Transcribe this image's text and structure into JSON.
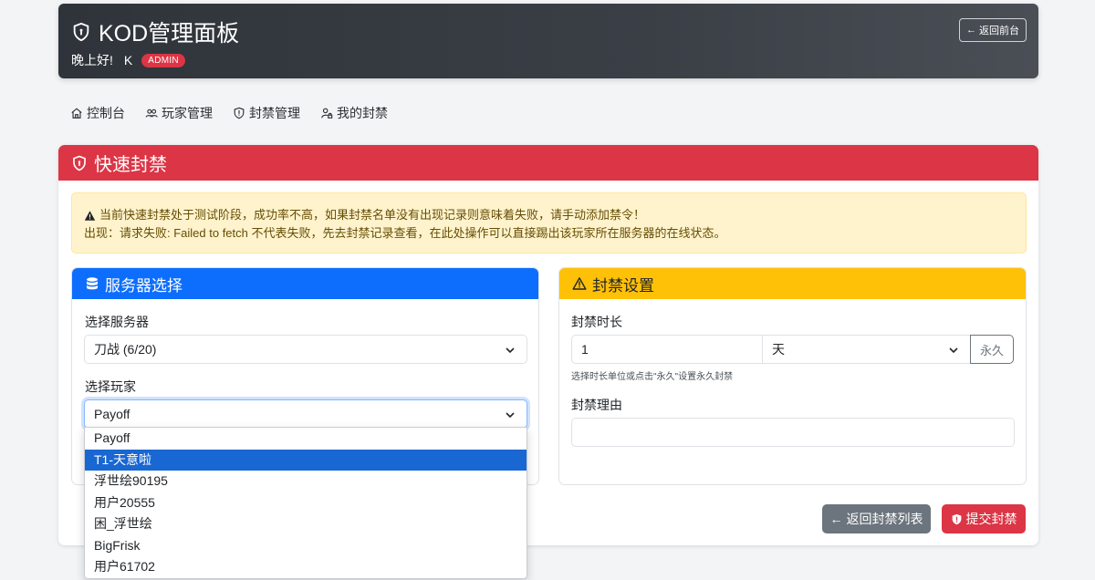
{
  "header": {
    "title": "KOD管理面板",
    "greeting": "晚上好!",
    "username": "K",
    "role_badge": "ADMIN",
    "back_button": "返回前台"
  },
  "nav": {
    "items": [
      {
        "label": "控制台",
        "icon": "home-icon"
      },
      {
        "label": "玩家管理",
        "icon": "users-icon"
      },
      {
        "label": "封禁管理",
        "icon": "shield-icon"
      },
      {
        "label": "我的封禁",
        "icon": "user-lock-icon"
      }
    ]
  },
  "main": {
    "title": "快速封禁",
    "alert_line1": "当前快速封禁处于测试阶段，成功率不高，如果封禁名单没有出现记录则意味着失败，请手动添加禁令！",
    "alert_line2": "出现：请求失败: Failed to fetch 不代表失败，先去封禁记录查看，在此处操作可以直接踢出该玩家所在服务器的在线状态。"
  },
  "server_panel": {
    "title": "服务器选择",
    "server_label": "选择服务器",
    "server_value": "刀战 (6/20)",
    "player_label": "选择玩家",
    "player_value": "Payoff",
    "player_options": [
      "Payoff",
      "T1-天意啦",
      "浮世绘90195",
      "用户20555",
      "困_浮世绘",
      "BigFrisk",
      "用户61702"
    ],
    "highlighted_option": "T1-天意啦"
  },
  "ban_panel": {
    "title": "封禁设置",
    "duration_label": "封禁时长",
    "duration_value": "1",
    "unit_value": "天",
    "permanent_button": "永久",
    "duration_help": "选择时长单位或点击\"永久\"设置永久封禁",
    "reason_label": "封禁理由",
    "reason_value": ""
  },
  "actions": {
    "back_list": "返回封禁列表",
    "submit": "提交封禁"
  },
  "colors": {
    "danger": "#dc3545",
    "primary": "#0d6efd",
    "warning": "#ffc107",
    "secondary": "#6c757d",
    "header_bg": "#343a40"
  }
}
